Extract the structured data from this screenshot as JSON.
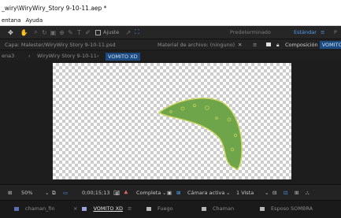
{
  "window": {
    "title": "_wiry\\WiryWiry_Story 9-10-11.aep *"
  },
  "menu": [
    "entana",
    "Ayuda"
  ],
  "toolbar": {
    "snap_label": "Ajuste",
    "workspaces": [
      "Predeterminado",
      "Estándar"
    ],
    "active_workspace": "Estándar"
  },
  "info": {
    "layer_text": "Capa: Malester/WiryWiry Story 9-10-11.psd",
    "material_text": "Material de archivo: (ninguno)",
    "composition_prefix": "Composición",
    "composition_name": "VOMITO XD"
  },
  "comp_tabs": {
    "partial": "ena3",
    "items": [
      "WiryWiry Story 9-10-11",
      "VOMITO XD"
    ]
  },
  "viewer_controls": {
    "zoom": "50%",
    "timecode": "0;00;15;13",
    "resolution": "Completa",
    "camera": "Cámara activa",
    "views": "1 Vista"
  },
  "timeline_tabs": [
    {
      "label": "chaman_fin",
      "color": "#5a6fb0",
      "active": false
    },
    {
      "label": "VOMITO XD",
      "color": "#9aa4d9",
      "active": true
    },
    {
      "label": "Fuego",
      "color": "#b7b7b7",
      "active": false
    },
    {
      "label": "Chaman",
      "color": "#b7b7b7",
      "active": false
    },
    {
      "label": "Esposo SOMBRA",
      "color": "#b7b7b7",
      "active": false
    }
  ],
  "colors": {
    "accent_blue": "#3a8df5",
    "shape_fill": "#6ea54a",
    "shape_outline": "#c8d25a",
    "panel_bg": "#1d1d1d"
  }
}
